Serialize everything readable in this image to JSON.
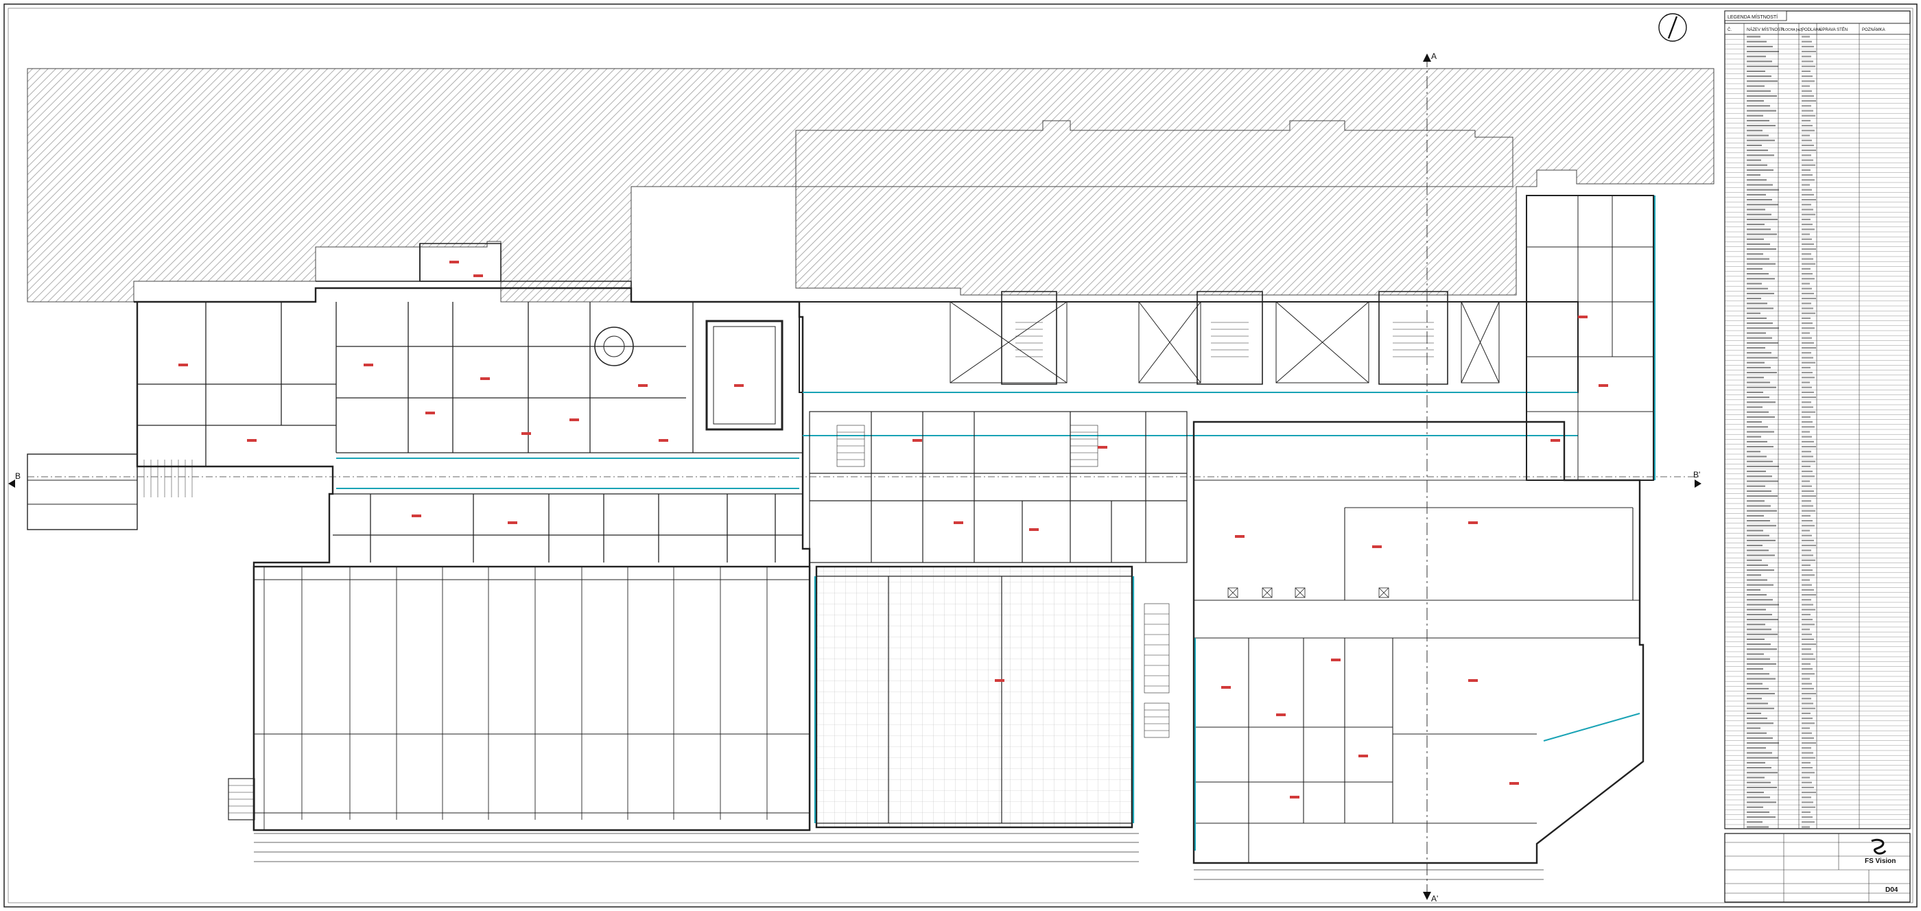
{
  "sheet": {
    "section_labels": {
      "left": "B",
      "right": "B'",
      "top": "A",
      "bottom": "A'"
    }
  },
  "legend_table": {
    "header": "LEGENDA MÍSTNOSTÍ",
    "columns": [
      "Č.",
      "NÁZEV MÍSTNOSTI",
      "PLOCHA [m2]",
      "PODLAHA",
      "ÚPRAVA STĚN",
      "POZNÁMKA"
    ]
  },
  "title_block": {
    "company": "FS Vision",
    "drawing_number": "D04"
  },
  "colors": {
    "line": "#222222",
    "hatch": "#9a9a9a",
    "cyan": "#19a3b5",
    "red_labels": "#d23b3b",
    "paper": "#ffffff"
  },
  "icons": {
    "north": "north-arrow-icon",
    "logo": "fs-vision-logo-icon"
  }
}
